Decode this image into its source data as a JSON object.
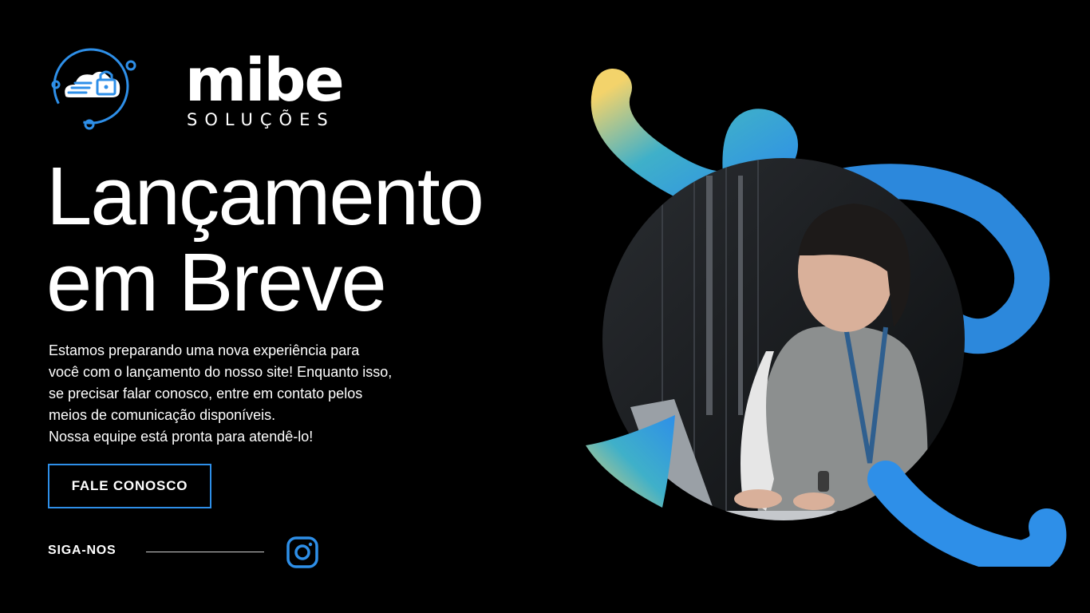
{
  "brand": {
    "name": "mibe",
    "subtitle": "SOLUÇÕES",
    "accent_color": "#2e8fe8"
  },
  "hero": {
    "title_line1": "Lançamento",
    "title_line2": "em Breve",
    "description_lines": [
      "Estamos preparando uma nova experiência para",
      "você com o lançamento do nosso site! Enquanto isso,",
      "se precisar falar conosco, entre em contato pelos",
      "meios de comunicação disponíveis.",
      "Nossa equipe está pronta para atendê-lo!"
    ]
  },
  "cta": {
    "label": "FALE CONOSCO"
  },
  "social": {
    "label": "SIGA-NOS",
    "icon": "instagram-icon"
  },
  "art": {
    "photo_subject": "woman-working-on-laptop-in-server-room-photo",
    "gradient_colors": [
      "#f3d36b",
      "#3fb0c9",
      "#2e8fe8"
    ]
  }
}
